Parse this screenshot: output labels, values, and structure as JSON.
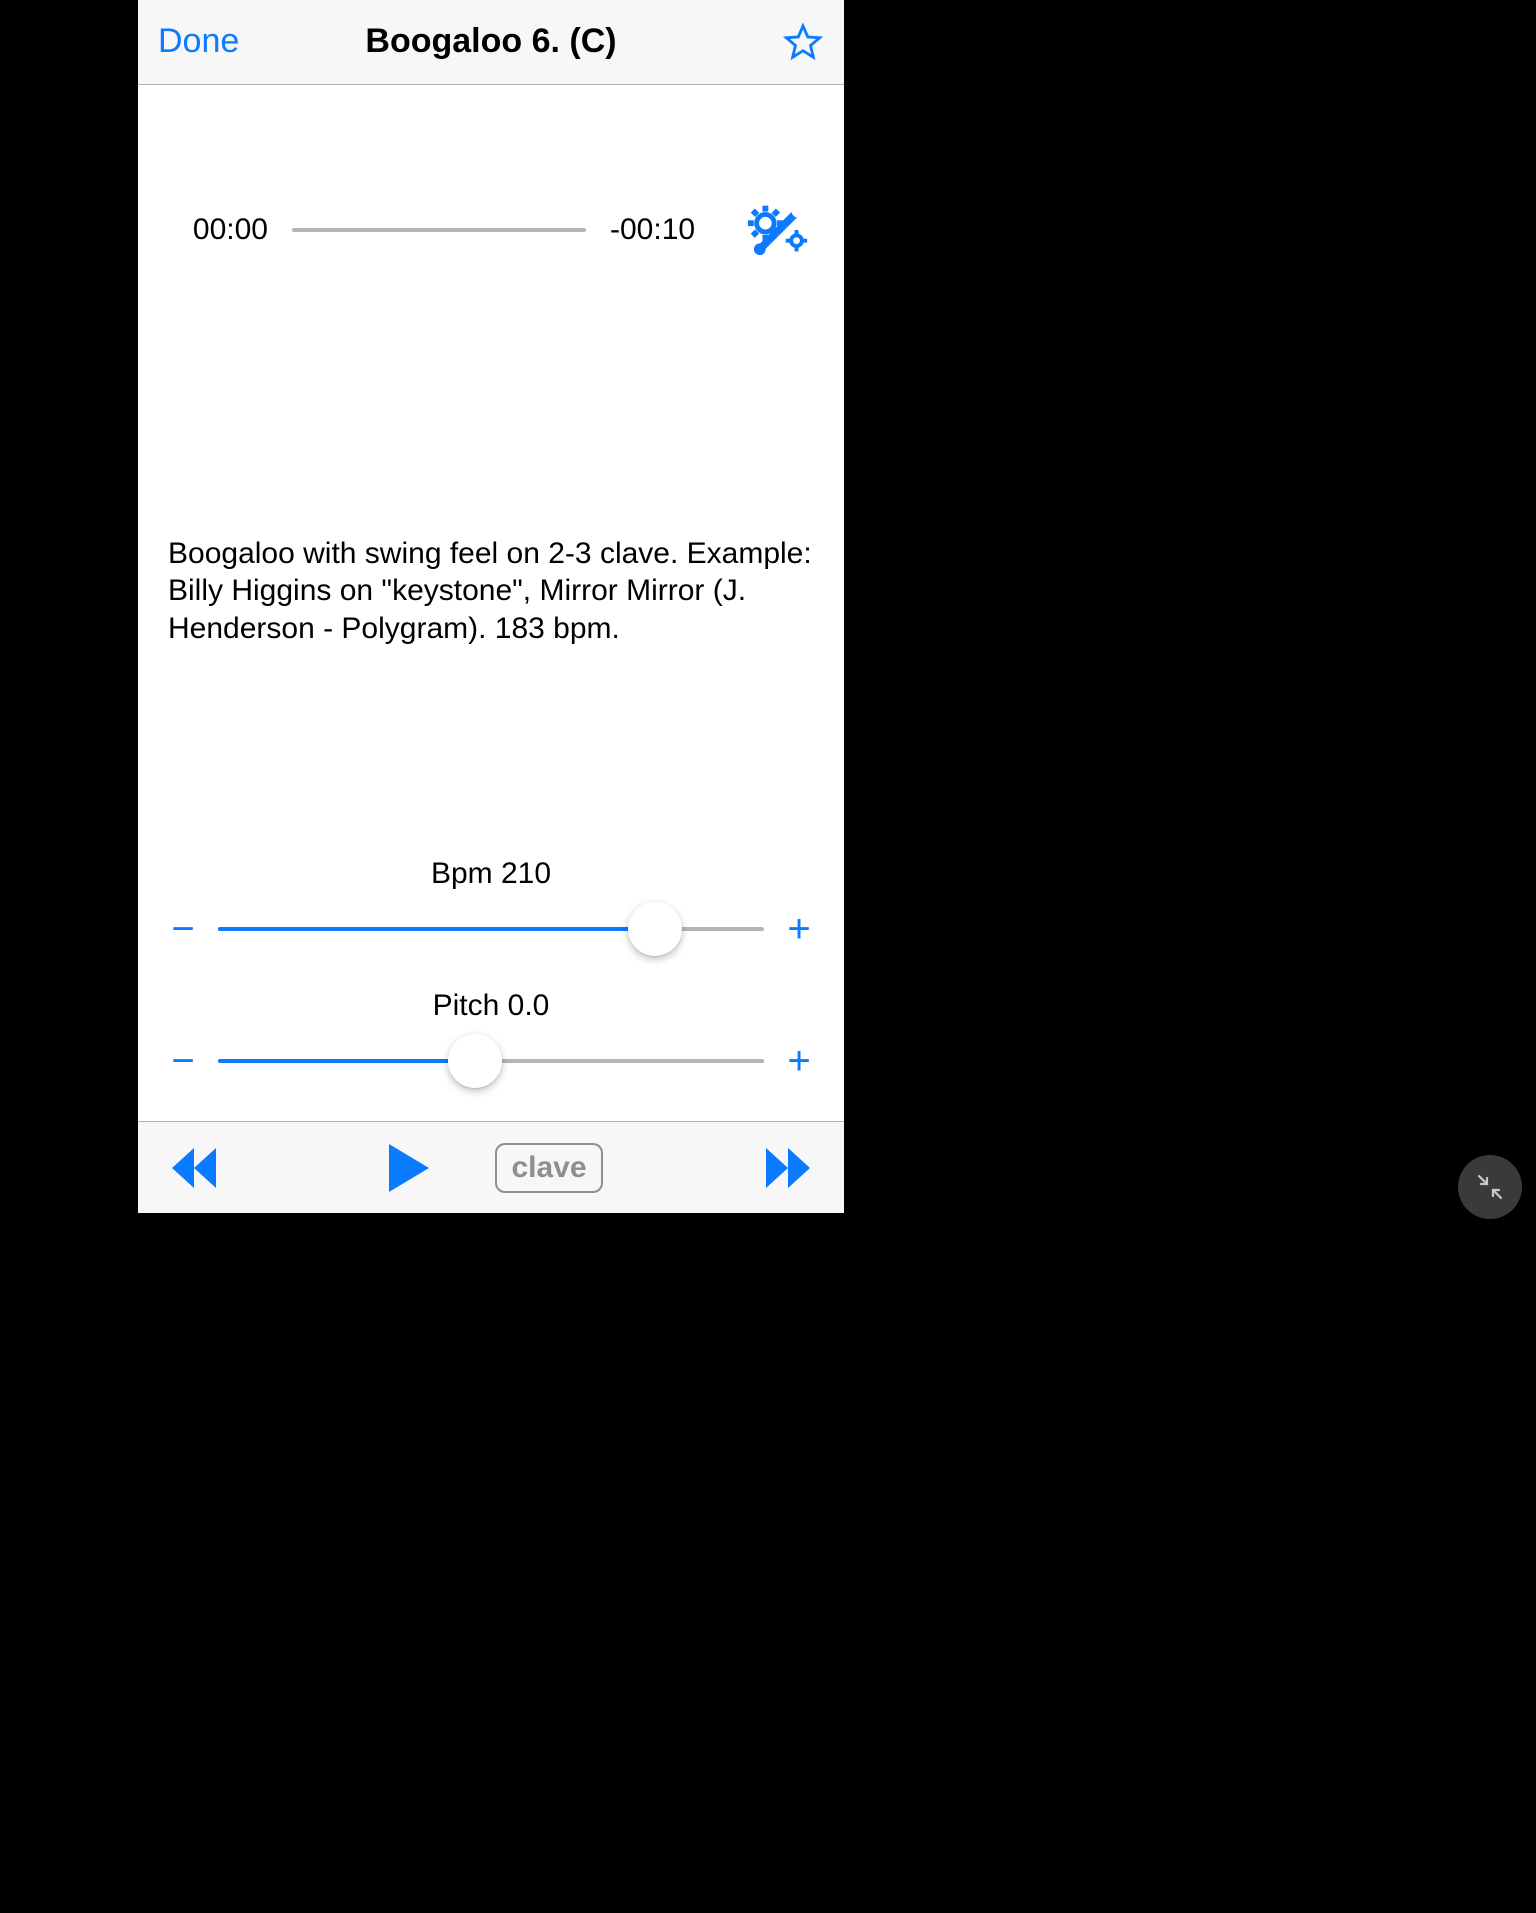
{
  "nav": {
    "done": "Done",
    "title": "Boogaloo  6. (C)"
  },
  "playback": {
    "elapsed": "00:00",
    "remaining": "-00:10",
    "progress_pct": 0
  },
  "description": "Boogaloo with swing feel on 2-3 clave. Example: Billy Higgins on \"keystone\", Mirror Mirror (J. Henderson - Polygram). 183 bpm.",
  "sliders": {
    "bpm": {
      "label": "Bpm 210",
      "pct": 80
    },
    "pitch": {
      "label": "Pitch 0.0",
      "pct": 47
    }
  },
  "toolbar": {
    "clave": "clave"
  },
  "colors": {
    "accent": "#0a7aff"
  }
}
